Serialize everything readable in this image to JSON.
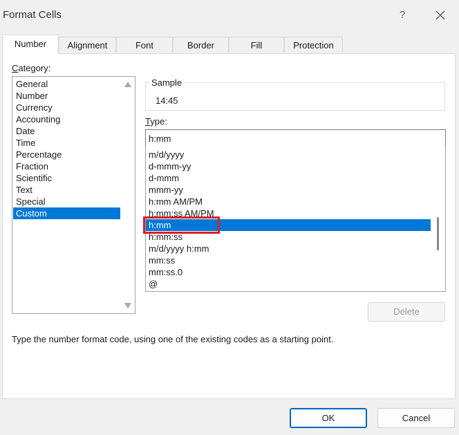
{
  "window": {
    "title": "Format Cells",
    "help_label": "?",
    "close_icon": "close-icon"
  },
  "tabs": [
    {
      "label": "Number",
      "active": true
    },
    {
      "label": "Alignment",
      "active": false
    },
    {
      "label": "Font",
      "active": false
    },
    {
      "label": "Border",
      "active": false
    },
    {
      "label": "Fill",
      "active": false
    },
    {
      "label": "Protection",
      "active": false
    }
  ],
  "category": {
    "label_accel": "C",
    "label_rest": "ategory:",
    "items": [
      "General",
      "Number",
      "Currency",
      "Accounting",
      "Date",
      "Time",
      "Percentage",
      "Fraction",
      "Scientific",
      "Text",
      "Special",
      "Custom"
    ],
    "selected": "Custom"
  },
  "sample": {
    "legend": "Sample",
    "value": "14:45"
  },
  "type": {
    "label_accel": "T",
    "label_rest": "ype:",
    "value": "h:mm",
    "formats": [
      "m/d/yyyy",
      "d-mmm-yy",
      "d-mmm",
      "mmm-yy",
      "h:mm AM/PM",
      "h:mm:ss AM/PM",
      "h:mm",
      "h:mm:ss",
      "m/d/yyyy h:mm",
      "mm:ss",
      "mm:ss.0",
      "@"
    ],
    "selected": "h:mm"
  },
  "buttons": {
    "delete": "Delete",
    "ok": "OK",
    "cancel": "Cancel"
  },
  "hint": "Type the number format code, using one of the existing codes as a starting point.",
  "colors": {
    "selection": "#0078d7",
    "highlight_border": "#e01e24",
    "ok_border": "#0067c0"
  }
}
